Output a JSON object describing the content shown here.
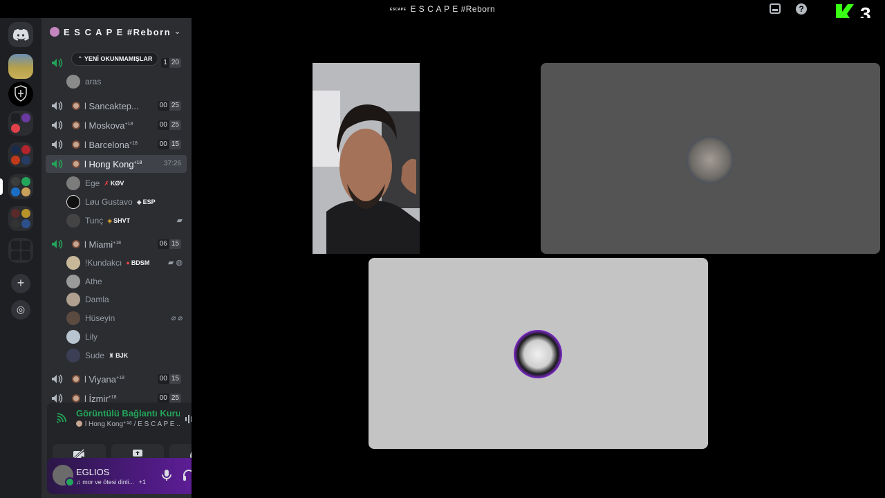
{
  "window": {
    "title": "E S C A P E #Reborn",
    "mini_logo": "ESCAPE"
  },
  "top_right": {
    "inbox_icon": "inbox-icon",
    "help_icon": "?",
    "brand_number": "3",
    "brand_color": "#39ff14"
  },
  "guild": {
    "name": "E S C A P E #Reborn"
  },
  "unread_banner": "⌃ YENİ OKUNMAMIŞLAR",
  "channels": [
    {
      "name": "l Sancaktep...",
      "sup": "",
      "count_a": "00",
      "count_b": "25",
      "users": []
    },
    {
      "name": "l Moskova",
      "sup": "+18",
      "count_a": "00",
      "count_b": "25",
      "users": []
    },
    {
      "name": "l Barcelona",
      "sup": "+18",
      "count_a": "00",
      "count_b": "15",
      "users": []
    },
    {
      "name": "l Hong Kong",
      "sup": "+18",
      "timer": "37:26",
      "users": [
        {
          "name": "Ege",
          "tag": "KØV"
        },
        {
          "name": "Løu Gustavo",
          "tag": "ESP"
        },
        {
          "name": "Tunç",
          "tag": "SHVT"
        }
      ]
    },
    {
      "name": "l Miami",
      "sup": "+18",
      "count_a": "06",
      "count_b": "15",
      "users": [
        {
          "name": "!Kundakcı",
          "tag": "BDSM"
        },
        {
          "name": "Athe",
          "tag": ""
        },
        {
          "name": "Damla",
          "tag": ""
        },
        {
          "name": "Hüseyin",
          "tag": ""
        },
        {
          "name": "Lily",
          "tag": ""
        },
        {
          "name": "Sude",
          "tag": "BJK"
        }
      ]
    },
    {
      "name": "l Viyana",
      "sup": "+18",
      "count_a": "00",
      "count_b": "15",
      "users": []
    },
    {
      "name": "l İzmir",
      "sup": "+18",
      "count_a": "00",
      "count_b": "25",
      "users": []
    }
  ],
  "top_partial": {
    "counts": "1",
    "count_b": "20",
    "user": "aras"
  },
  "voice": {
    "status": "Görüntülü Bağlantı Kuruldu",
    "location": "l Hong Kong⁺¹⁸ / E S C A P E ..."
  },
  "account": {
    "name": "EGLIOS",
    "status": "♫ mor ve ötesi dinli...",
    "extra": "+1"
  }
}
